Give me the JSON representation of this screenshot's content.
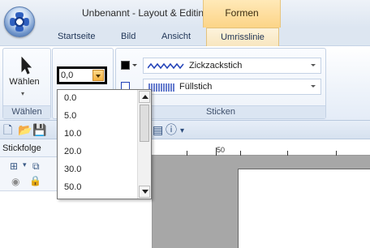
{
  "window": {
    "title": "Unbenannt - Layout & Editing",
    "context_tab": "Formen"
  },
  "tabs": [
    "Startseite",
    "Bild",
    "Ansicht",
    "Umrisslinie"
  ],
  "active_tab": "Umrisslinie",
  "ribbon": {
    "select_group": {
      "button_label": "Wählen",
      "group_label": "Wählen"
    },
    "width_combo": {
      "value": "0,0"
    },
    "sticken_group": {
      "line_stitch": "Zickzackstich",
      "fill_stitch": "Füllstich",
      "group_label": "Sticken",
      "swatch_color": "#000000"
    }
  },
  "dropdown": {
    "options": [
      "0.0",
      "5.0",
      "10.0",
      "20.0",
      "30.0",
      "50.0"
    ]
  },
  "panel": {
    "title": "Stickfolge"
  },
  "ruler": {
    "mark_50": "50"
  },
  "colors": {
    "context_tab": "#fcd487",
    "accent_border": "#000000"
  }
}
